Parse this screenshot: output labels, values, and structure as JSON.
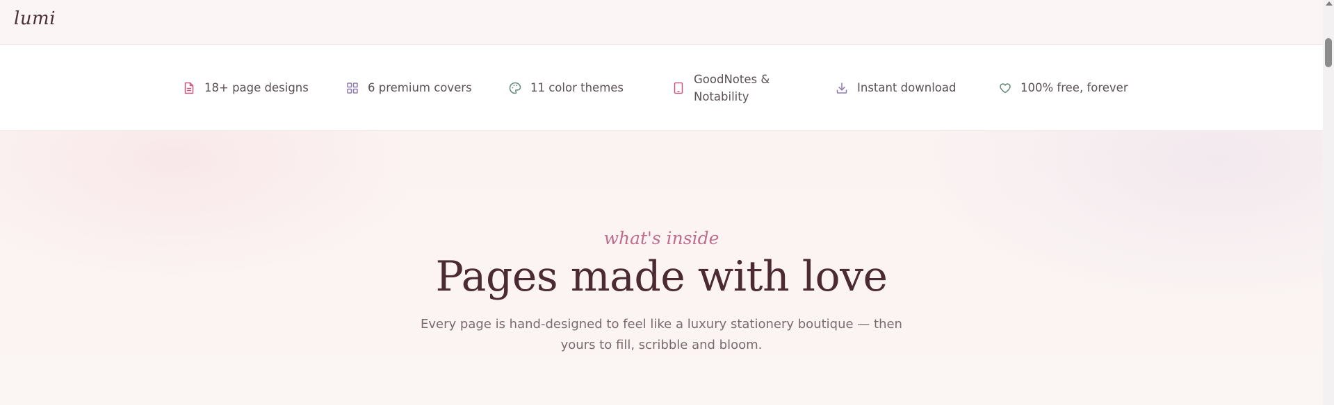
{
  "header": {
    "logo_text": "lumi"
  },
  "features": [
    {
      "label": "18+ page designs",
      "icon": "document-icon",
      "color": "#c8577f"
    },
    {
      "label": "6 premium covers",
      "icon": "grid-icon",
      "color": "#8f7ab0"
    },
    {
      "label": "11 color themes",
      "icon": "palette-icon",
      "color": "#5f8a77"
    },
    {
      "label": "GoodNotes & Notability",
      "icon": "tablet-icon",
      "color": "#c8577f"
    },
    {
      "label": "Instant download",
      "icon": "download-icon",
      "color": "#8f7ab0"
    },
    {
      "label": "100% free, forever",
      "icon": "heart-icon",
      "color": "#5f8a77"
    }
  ],
  "hero": {
    "eyebrow": "what's inside",
    "title": "Pages made with love",
    "subtitle": "Every page is hand-designed to feel like a luxury stationery boutique — then yours to fill, scribble and bloom."
  },
  "colors": {
    "rose": "#c8577f",
    "lavender": "#8f7ab0",
    "sage": "#5f8a77",
    "title": "#4b2a33",
    "eyebrow": "#c06d8e"
  }
}
